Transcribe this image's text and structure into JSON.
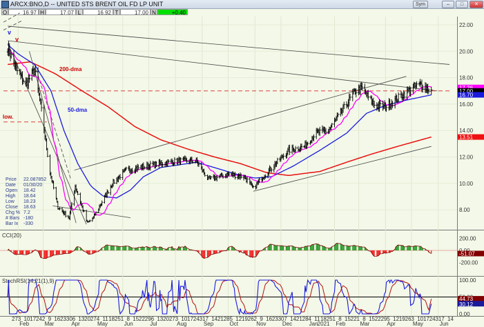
{
  "window": {
    "title": "ARCX:BNO,D -- UNITED STS BRENT OIL FD LP UNIT",
    "buttons": [
      "–",
      "□",
      "✕"
    ],
    "sym_label": "Sym"
  },
  "ohlc": {
    "o_label": "O",
    "o": "16.97",
    "h_label": "H",
    "h": "17.07",
    "l_label": "L",
    "l": "16.92",
    "t_label": "T",
    "t": "17.00",
    "n_label": "N",
    "n": "+0.40"
  },
  "colors": {
    "bg": "#f3f8e8",
    "price": "#000000",
    "ma20": "#ff00ff",
    "ma50": "#1a1adc",
    "ma200": "#e81010",
    "trend": "#555555",
    "cci_pos": "#2c9a2c",
    "cci_neg": "#ee2222",
    "stoch_k": "#1a1adc",
    "stoch_d": "#b01010"
  },
  "info_box": [
    [
      "Price",
      "22.087852"
    ],
    [
      "Date",
      "01/30/20"
    ],
    [
      "Open",
      "18.42"
    ],
    [
      "High",
      "18.64"
    ],
    [
      "Low",
      "18.23"
    ],
    [
      "Close",
      "18.63"
    ],
    [
      "Chg %",
      "7.2"
    ],
    [
      "# Bars",
      "-180"
    ],
    [
      "Bar Ix",
      "-330"
    ]
  ],
  "annotations": {
    "ma200": "200-dma",
    "ma50": "50-dma",
    "low": "low.",
    "v1": "v",
    "v2": "v"
  },
  "chart_data": {
    "type": "line",
    "title": "ARCX:BNO,D",
    "price_axis": {
      "ticks": [
        "22.00",
        "20.00",
        "18.00",
        "16.00",
        "14.00",
        "12.00",
        "10.00",
        "8.00"
      ],
      "ylim": [
        6.8,
        23.2
      ]
    },
    "price_tags": [
      {
        "label": "17.26",
        "value": 17.26,
        "color": "#ff00ff"
      },
      {
        "label": "17.00",
        "value": 17.0,
        "color": "#000000"
      },
      {
        "label": "16.70",
        "value": 16.7,
        "color": "#1a1adc"
      },
      {
        "label": "13.51",
        "value": 13.51,
        "color": "#ee1111"
      }
    ],
    "close_keypoints": [
      [
        "2020-01-20",
        20.3
      ],
      [
        "2020-01-30",
        18.6
      ],
      [
        "2020-02-10",
        17.5
      ],
      [
        "2020-02-20",
        18.6
      ],
      [
        "2020-02-28",
        15.5
      ],
      [
        "2020-03-09",
        10.8
      ],
      [
        "2020-03-18",
        8.2
      ],
      [
        "2020-03-31",
        7.4
      ],
      [
        "2020-04-07",
        9.8
      ],
      [
        "2020-04-21",
        7.0
      ],
      [
        "2020-04-28",
        7.4
      ],
      [
        "2020-05-08",
        8.6
      ],
      [
        "2020-05-20",
        10.0
      ],
      [
        "2020-06-05",
        11.0
      ],
      [
        "2020-06-20",
        11.2
      ],
      [
        "2020-07-15",
        11.5
      ],
      [
        "2020-08-05",
        11.7
      ],
      [
        "2020-08-25",
        11.7
      ],
      [
        "2020-09-08",
        10.3
      ],
      [
        "2020-09-20",
        10.5
      ],
      [
        "2020-10-01",
        10.7
      ],
      [
        "2020-10-20",
        10.5
      ],
      [
        "2020-10-30",
        9.6
      ],
      [
        "2020-11-10",
        10.5
      ],
      [
        "2020-11-25",
        11.5
      ],
      [
        "2020-12-10",
        12.5
      ],
      [
        "2020-12-28",
        12.8
      ],
      [
        "2021-01-10",
        13.8
      ],
      [
        "2021-01-25",
        14.0
      ],
      [
        "2021-02-10",
        15.5
      ],
      [
        "2021-02-25",
        17.0
      ],
      [
        "2021-03-05",
        17.2
      ],
      [
        "2021-03-12",
        16.5
      ],
      [
        "2021-03-20",
        15.9
      ],
      [
        "2021-04-01",
        15.8
      ],
      [
        "2021-04-12",
        16.3
      ],
      [
        "2021-04-25",
        16.9
      ],
      [
        "2021-05-05",
        17.3
      ],
      [
        "2021-05-12",
        17.5
      ],
      [
        "2021-05-24",
        17.0
      ]
    ],
    "ma200_keypoints": [
      [
        "2020-01-20",
        19.0
      ],
      [
        "2020-02-15",
        19.2
      ],
      [
        "2020-03-15",
        18.3
      ],
      [
        "2020-04-15",
        17.0
      ],
      [
        "2020-05-15",
        15.8
      ],
      [
        "2020-06-15",
        14.3
      ],
      [
        "2020-07-15",
        13.3
      ],
      [
        "2020-08-15",
        12.6
      ],
      [
        "2020-09-15",
        12.0
      ],
      [
        "2020-10-15",
        11.5
      ],
      [
        "2020-11-15",
        10.8
      ],
      [
        "2020-12-10",
        10.6
      ],
      [
        "2021-01-15",
        10.9
      ],
      [
        "2021-02-15",
        11.6
      ],
      [
        "2021-03-15",
        12.2
      ],
      [
        "2021-04-15",
        12.8
      ],
      [
        "2021-05-24",
        13.51
      ]
    ],
    "ma50_keypoints": [
      [
        "2020-01-20",
        20.5
      ],
      [
        "2020-02-01",
        19.8
      ],
      [
        "2020-02-20",
        19.0
      ],
      [
        "2020-03-10",
        17.0
      ],
      [
        "2020-03-25",
        14.0
      ],
      [
        "2020-04-10",
        11.5
      ],
      [
        "2020-04-25",
        9.8
      ],
      [
        "2020-05-10",
        9.0
      ],
      [
        "2020-05-25",
        8.9
      ],
      [
        "2020-06-10",
        9.5
      ],
      [
        "2020-06-25",
        10.5
      ],
      [
        "2020-07-15",
        11.2
      ],
      [
        "2020-08-05",
        11.4
      ],
      [
        "2020-08-25",
        11.6
      ],
      [
        "2020-09-15",
        11.2
      ],
      [
        "2020-10-10",
        10.7
      ],
      [
        "2020-11-01",
        10.4
      ],
      [
        "2020-11-20",
        10.5
      ],
      [
        "2020-12-15",
        11.3
      ],
      [
        "2021-01-15",
        12.5
      ],
      [
        "2021-02-15",
        13.8
      ],
      [
        "2021-03-10",
        15.3
      ],
      [
        "2021-04-01",
        15.9
      ],
      [
        "2021-04-25",
        16.3
      ],
      [
        "2021-05-24",
        16.7
      ]
    ],
    "trendlines": [
      {
        "from": [
          "2020-01-20",
          21.9
        ],
        "to": [
          "2021-06-14",
          19.0
        ],
        "dash": false
      },
      {
        "from": [
          "2020-01-20",
          20.8
        ],
        "to": [
          "2021-05-31",
          17.0
        ],
        "dash": false
      },
      {
        "from": [
          "2020-04-06",
          11.0
        ],
        "to": [
          "2021-04-25",
          18.1
        ],
        "dash": false
      },
      {
        "from": [
          "2020-10-30",
          9.4
        ],
        "to": [
          "2021-05-24",
          12.8
        ],
        "dash": false
      },
      {
        "from": [
          "2020-01-20",
          20.6
        ],
        "to": [
          "2020-04-20",
          6.9
        ],
        "dash": false
      },
      {
        "from": [
          "2020-02-14",
          20.0
        ],
        "to": [
          "2020-04-08",
          7.0
        ],
        "dash": false
      },
      {
        "from": [
          "2020-02-20",
          19.0
        ],
        "to": [
          "2020-04-02",
          10.3
        ],
        "dash": true
      },
      {
        "from": [
          "2020-03-12",
          8.3
        ],
        "to": [
          "2020-06-10",
          7.4
        ],
        "dash": false
      },
      {
        "from": [
          "2020-01-15",
          22.2
        ],
        "to": [
          "2020-02-03",
          22.9
        ],
        "dash": true
      },
      {
        "from": [
          "2020-01-15",
          21.6
        ],
        "to": [
          "2020-02-05",
          22.3
        ],
        "dash": true
      }
    ],
    "hlines": [
      {
        "value": 17.0,
        "from": "2020-01-15",
        "to": "2021-06-14",
        "color": "#e04040",
        "dash": true
      },
      {
        "value": 14.65,
        "from": "2020-01-15",
        "to": "2020-03-05",
        "color": "#e04040",
        "dash": true
      }
    ],
    "cci": {
      "label": "CCI(20)",
      "ticks": [
        "200.00",
        "0.00",
        "-200.00"
      ],
      "last": "-51.07",
      "ylim": [
        -330,
        280
      ]
    },
    "stochrsi": {
      "label": "StochRSI(14,21(1),9)",
      "ticks": [
        "100.00",
        "50.00",
        "0.00"
      ],
      "last_k": "30.12",
      "last_d": "44.73",
      "ylim": [
        -5,
        105
      ]
    },
    "x_axis": {
      "start": "2020-01-20",
      "end": "2021-06-20",
      "months": [
        [
          "Feb",
          "2020-02-01"
        ],
        [
          "Mar",
          "2020-03-01"
        ],
        [
          "Apr",
          "2020-04-01"
        ],
        [
          "May",
          "2020-05-01"
        ],
        [
          "Jun",
          "2020-06-01"
        ],
        [
          "Jul",
          "2020-07-01"
        ],
        [
          "Aug",
          "2020-08-01"
        ],
        [
          "Sep",
          "2020-09-01"
        ],
        [
          "Oct",
          "2020-10-01"
        ],
        [
          "Nov",
          "2020-11-01"
        ],
        [
          "Dec",
          "2020-12-01"
        ],
        [
          "Jan",
          "2021-01-01"
        ],
        [
          "Feb",
          "2021-02-01"
        ],
        [
          "Mar",
          "2021-03-01"
        ],
        [
          "Apr",
          "2021-04-01"
        ],
        [
          "May",
          "2021-05-01"
        ],
        [
          "Jun",
          "2021-06-01"
        ]
      ],
      "year_label": "2021"
    }
  }
}
